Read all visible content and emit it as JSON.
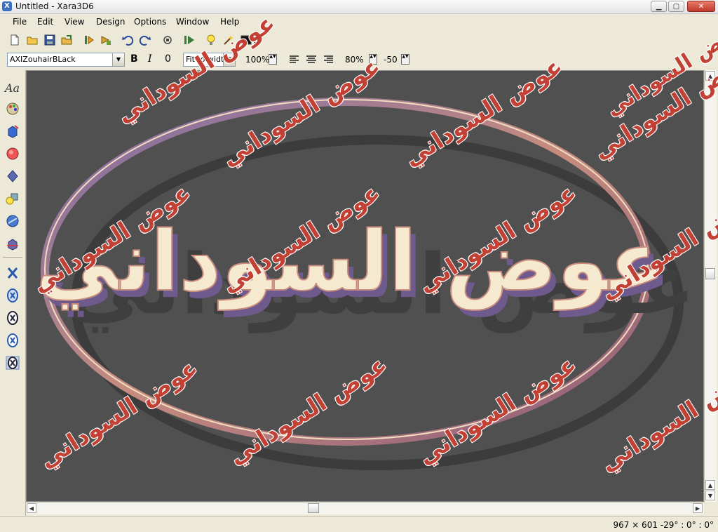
{
  "window": {
    "title": "Untitled - Xara3D6",
    "min_glyph": "▁",
    "max_glyph": "▢",
    "close_glyph": "✕"
  },
  "menu": [
    {
      "label": "File"
    },
    {
      "label": "Edit"
    },
    {
      "label": "View"
    },
    {
      "label": "Design"
    },
    {
      "label": "Options"
    },
    {
      "label": "Window"
    },
    {
      "label": "Help"
    }
  ],
  "toolbar": {
    "font_name": "AXIZouhairBLack",
    "bold_glyph": "B",
    "italic_glyph": "I",
    "outline_glyph": "0",
    "fit_mode": "Fit to width",
    "zoom": "100%",
    "line_spacing": "80%",
    "char_spacing": "-50",
    "spin_glyph": "▲▼",
    "dropdown_glyph": "▼"
  },
  "left_tools": {
    "text_tool": "Aa"
  },
  "canvas": {
    "main_text": "عوض السوداني",
    "background_color": "#505050",
    "text_color": "#f5e9d0",
    "ring_color": "#c78c7e"
  },
  "watermark": {
    "text": "عوض السوداني",
    "color": "#c34034"
  },
  "scroll": {
    "up": "▲",
    "down": "▼",
    "left": "◀",
    "right": "▶"
  },
  "status": {
    "text": "967 × 601 -29° : 0° : 0°"
  }
}
